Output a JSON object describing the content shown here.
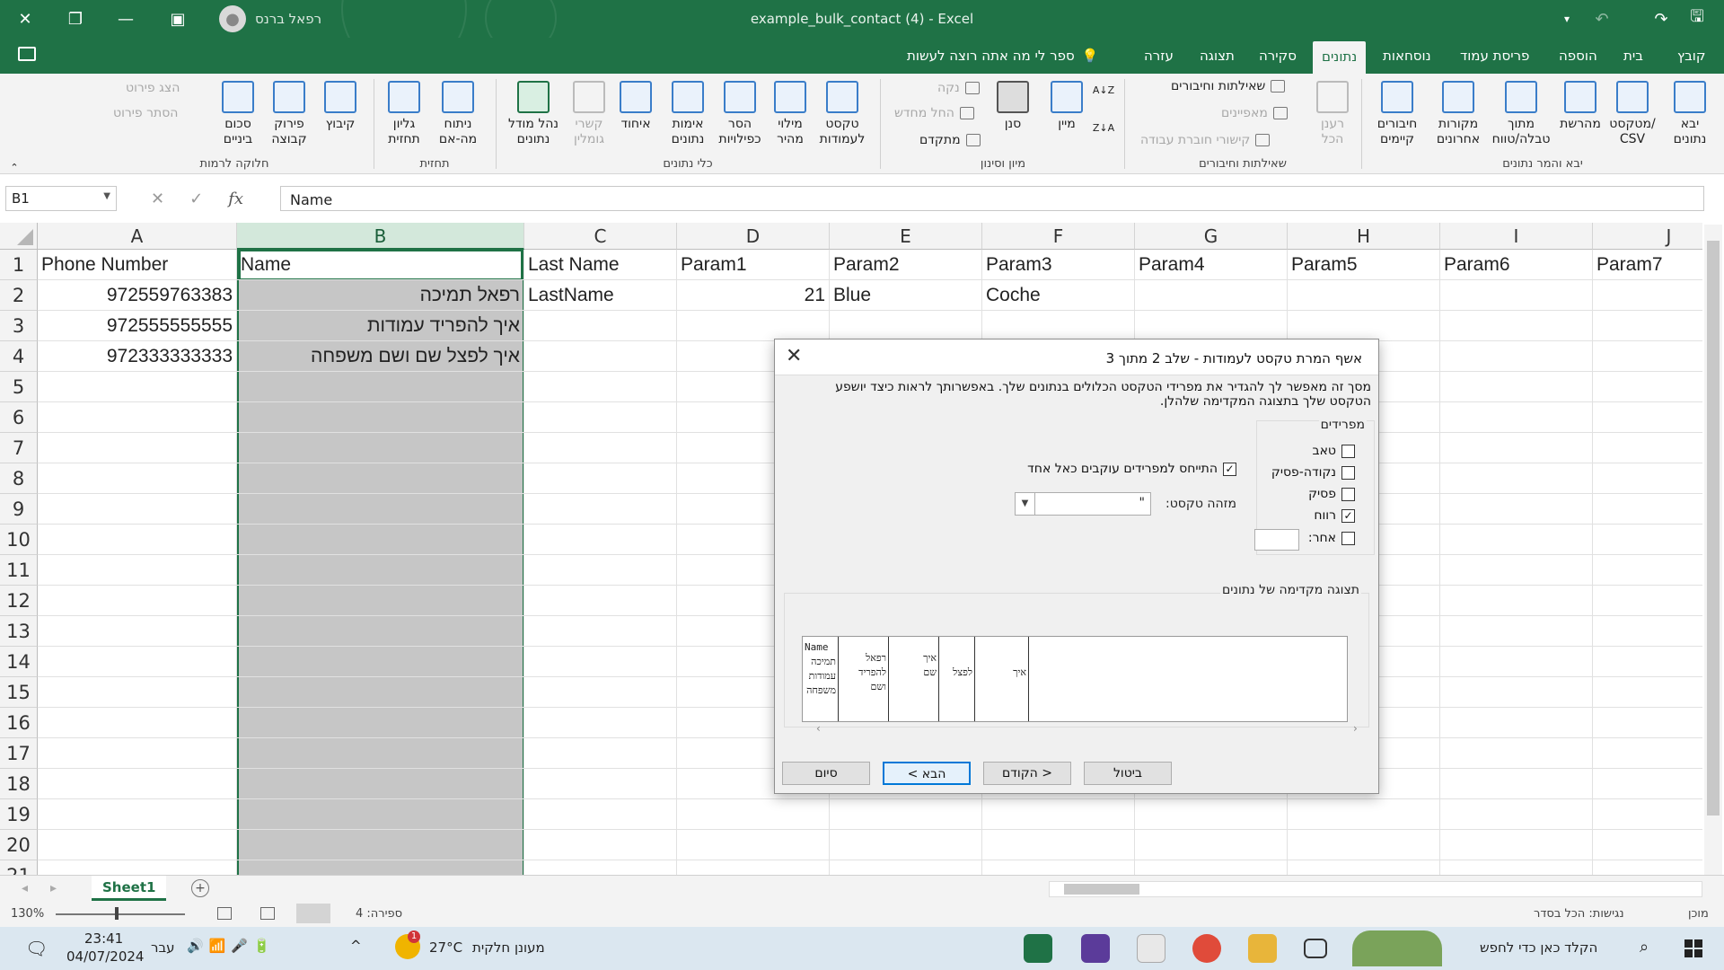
{
  "window": {
    "title": "example_bulk_contact (4)  -  Excel",
    "user": "רפאל ברנס"
  },
  "tabs": [
    "קובץ",
    "בית",
    "הוספה",
    "פריסת עמוד",
    "נוסחאות",
    "נתונים",
    "סקירה",
    "תצוגה",
    "עזרה"
  ],
  "tell_me": "ספר לי מה אתה רוצה לעשות",
  "ribbon": {
    "groups": {
      "get_transform": "יבא והמר נתונים",
      "queries": "שאילתות וחיבורים",
      "sort_filter": "מיון וסינון",
      "data_tools": "כלי נתונים",
      "forecast": "תחזית",
      "outline": "חלוקה לרמות"
    },
    "get_data": "יבא\nנתונים",
    "from_text": "מטקסט/\nCSV",
    "from_web": "מהרשת",
    "from_table": "מתוך\nטבלה/טווח",
    "recent_sources": "מקורות\nאחרונים",
    "existing_connections": "חיבורים\nקיימים",
    "refresh_all": "רענן\nהכל",
    "queries_connections": "שאילתות וחיבורים",
    "properties": "מאפיינים",
    "edit_links": "קישורי חוברת עבודה",
    "sort_az": "AZ",
    "sort": "מיין",
    "filter": "סנן",
    "clear": "נקה",
    "reapply": "החל מחדש",
    "advanced": "מתקדם",
    "text_to_columns": "טקסט\nלעמודות",
    "flash_fill": "מילוי\nמהיר",
    "remove_duplicates": "הסר\nכפילויות",
    "data_validation": "אימות\nנתונים",
    "consolidate": "איחוד",
    "relationships": "קשרי\nגומלין",
    "data_model": "נהל מודל\nנתונים",
    "what_if": "ניתוח\nמה-אם",
    "forecast_sheet": "גליון\nתחזית",
    "group": "קיבוץ",
    "ungroup": "פירוק\nקבוצה",
    "subtotal": "סכום\nביניים",
    "show_detail": "הצג פירוט",
    "hide_detail": "הסתר פירוט"
  },
  "formula_bar": {
    "name_box": "B1",
    "fx": "fx",
    "content": "Name"
  },
  "columns": [
    "A",
    "B",
    "C",
    "D",
    "E",
    "F",
    "G",
    "H",
    "I",
    "J"
  ],
  "rows": [
    "1",
    "2",
    "3",
    "4",
    "5",
    "6",
    "7",
    "8",
    "9",
    "10",
    "11",
    "12",
    "13",
    "14",
    "15",
    "16",
    "17",
    "18",
    "19",
    "20",
    "21"
  ],
  "cells": {
    "A1": "Phone Number",
    "B1": "Name",
    "C1": "Last Name",
    "D1": "Param1",
    "E1": "Param2",
    "F1": "Param3",
    "G1": "Param4",
    "H1": "Param5",
    "I1": "Param6",
    "J1": "Param7",
    "A2": "972559763383",
    "B2": "רפאל תמיכה",
    "C2": "LastName",
    "D2": "21",
    "E2": "Blue",
    "F2": "Coche",
    "A3": "972555555555",
    "B3": "איך להפריד עמודות",
    "A4": "972333333333",
    "B4": "איך לפצל שם ושם משפחה"
  },
  "sheet_tab": "Sheet1",
  "status": {
    "mode": "מוכן",
    "accessibility": "נגישות: הכל בסדר",
    "count": "ספירה: 4",
    "zoom": "130%"
  },
  "taskbar": {
    "search": "הקלד כאן כדי לחפש",
    "weather": "מעונן חלקית",
    "temp": "27°C",
    "lang": "עבר",
    "time": "23:41",
    "date": "04/07/2024",
    "badge": "1"
  },
  "dialog": {
    "title": "אשף המרת טקסט לעמודות - שלב 2 מתוך 3",
    "description": "מסך זה מאפשר לך להגדיר את מפרידי הטקסט הכלולים בנתונים שלך. באפשרותך לראות כיצד יושפע הטקסט שלך בתצוגה המקדימה שלהלן.",
    "delimiters_label": "מפרידים",
    "tab": "טאב",
    "semicolon": "נקודה-פסיק",
    "comma": "פסיק",
    "space": "רווח",
    "other": "אחר:",
    "consecutive": "התייחס למפרידים עוקבים כאל אחד",
    "qualifier_label": "מזהה טקסט:",
    "qualifier_value": "\"",
    "preview_label": "תצוגה מקדימה של נתונים",
    "preview_cols": [
      [
        "Name",
        "תמיכה",
        "עמודות",
        "משפחה"
      ],
      [
        "רפאל",
        "להפריד",
        "ושם"
      ],
      [
        "איך",
        "שם"
      ],
      [
        "לפצל"
      ],
      [
        "איך"
      ]
    ],
    "btn_cancel": "ביטול",
    "btn_back": "< הקודם",
    "btn_next": "הבא >",
    "btn_finish": "סיום",
    "checked": {
      "tab": false,
      "semicolon": false,
      "comma": false,
      "space": true,
      "other": false,
      "consecutive": true
    }
  }
}
